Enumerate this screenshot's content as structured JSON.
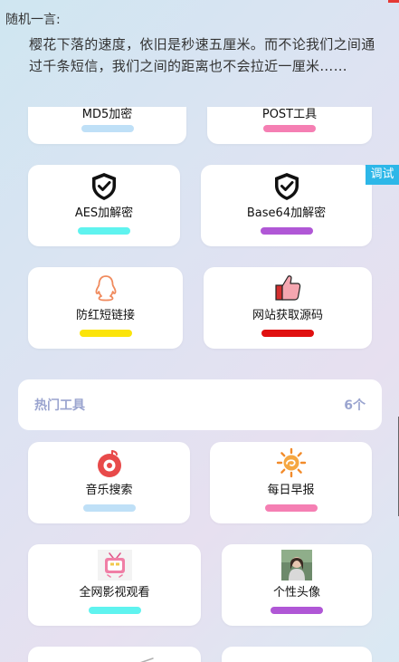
{
  "quote": {
    "label": "随机一言:",
    "text": "樱花下落的速度，依旧是秒速五厘米。而不论我们之间通过千条短信，我们之间的距离也不会拉近一厘米……"
  },
  "debug_label": "调试",
  "tools": [
    {
      "label": "MD5加密",
      "bar_color": "#bfe0f7"
    },
    {
      "label": "POST工具",
      "bar_color": "#f57fb3"
    },
    {
      "label": "AES加解密",
      "bar_color": "#5ff3ef",
      "icon": "shield-check-icon"
    },
    {
      "label": "Base64加解密",
      "bar_color": "#b057d6",
      "icon": "shield-check-icon"
    },
    {
      "label": "防红短链接",
      "bar_color": "#fbe40a",
      "icon": "qq-penguin-icon"
    },
    {
      "label": "网站获取源码",
      "bar_color": "#e01010",
      "icon": "thumbs-up-icon"
    }
  ],
  "hot_section": {
    "title": "热门工具",
    "count": "6个"
  },
  "hot_tools": [
    {
      "label": "音乐搜索",
      "bar_color": "#bfe0f7",
      "icon": "music-disc-icon"
    },
    {
      "label": "每日早报",
      "bar_color": "#f57fb3",
      "icon": "sun-icon"
    },
    {
      "label": "全网影视观看",
      "bar_color": "#5ff3ef",
      "icon": "tv-icon"
    },
    {
      "label": "个性头像",
      "bar_color": "#b057d6",
      "icon": "avatar-photo-icon"
    }
  ],
  "colors": {
    "accent": "#2db7e8",
    "section_text": "#9aa4cf"
  }
}
